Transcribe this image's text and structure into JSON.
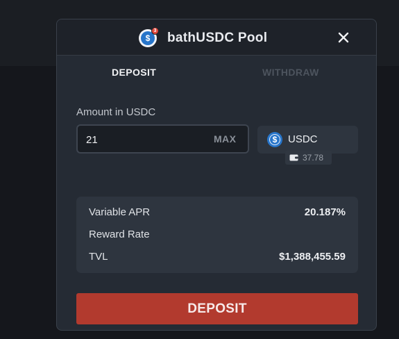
{
  "modal": {
    "title": "bathUSDC Pool",
    "pool_badge": "3"
  },
  "tabs": [
    {
      "label": "DEPOSIT",
      "active": true
    },
    {
      "label": "WITHDRAW",
      "active": false
    }
  ],
  "amount": {
    "label": "Amount in USDC",
    "value": "21",
    "max_label": "MAX"
  },
  "token": {
    "symbol": "USDC",
    "icon_glyph": "$",
    "balance": "37.78"
  },
  "stats": [
    {
      "label": "Variable APR",
      "value": "20.187%"
    },
    {
      "label": "Reward Rate",
      "value": ""
    },
    {
      "label": "TVL",
      "value": "$1,388,455.59"
    }
  ],
  "action": {
    "label": "DEPOSIT"
  },
  "colors": {
    "primary_action": "#b23a2e",
    "usdc_blue": "#2775ca",
    "modal_bg": "#252b34"
  }
}
